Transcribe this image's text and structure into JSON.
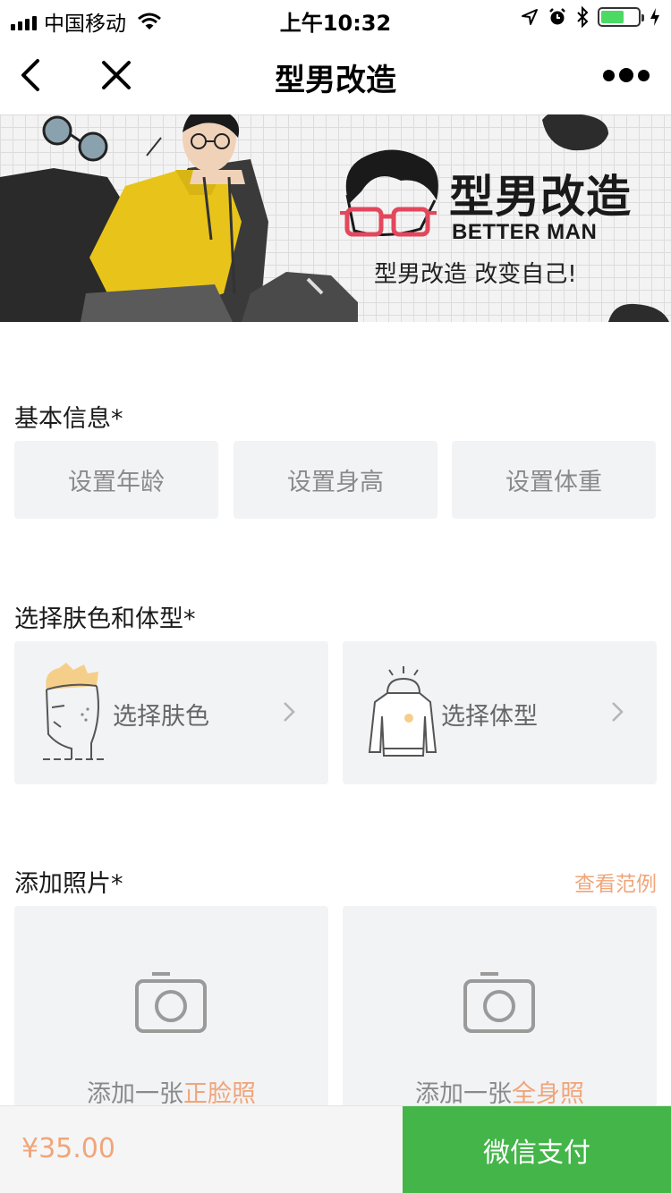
{
  "status_bar": {
    "carrier": "中国移动",
    "time": "上午10:32"
  },
  "nav": {
    "title": "型男改造",
    "back_icon": "chevron-left-icon",
    "close_icon": "close-icon",
    "more_icon": "more-dots-icon"
  },
  "banner": {
    "brand_title": "型男改造",
    "brand_subtitle": "BETTER  MAN",
    "slogan": "型男改造 改变自己!"
  },
  "basic_info": {
    "title": "基本信息*",
    "age_button": "设置年龄",
    "height_button": "设置身高",
    "weight_button": "设置体重"
  },
  "skin_body": {
    "title": "选择肤色和体型*",
    "skin_label": "选择肤色",
    "body_label": "选择体型"
  },
  "photos": {
    "title": "添加照片*",
    "example_link": "查看范例",
    "front_prefix": "添加一张",
    "front_highlight": "正脸照",
    "full_prefix": "添加一张",
    "full_highlight": "全身照"
  },
  "bottom": {
    "price": "¥35.00",
    "pay_button": "微信支付"
  },
  "colors": {
    "accent_orange": "#f0a57a",
    "pay_green": "#44b549",
    "card_bg": "#f2f3f5"
  }
}
